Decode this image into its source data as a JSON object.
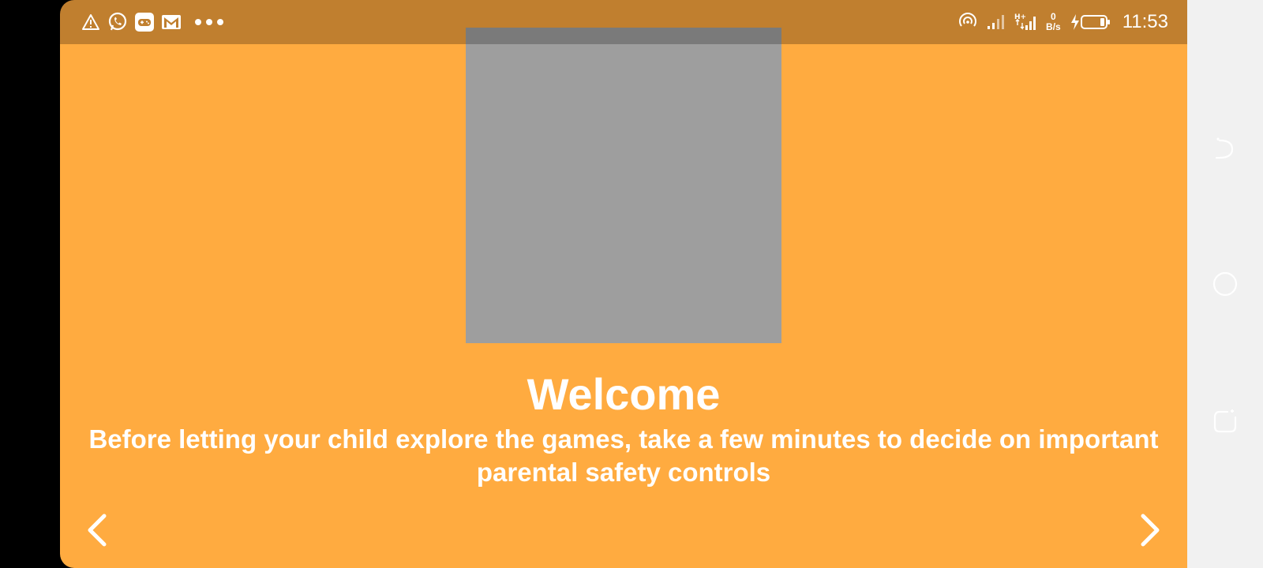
{
  "status_bar": {
    "left_icons": [
      "warning-icon",
      "whatsapp-icon",
      "game-controller-icon",
      "gmail-icon",
      "more-dots-icon"
    ],
    "net_speed_value": "0",
    "net_speed_unit": "B/s",
    "time": "11:53",
    "color": "#C07F2F"
  },
  "main": {
    "background_color": "#FFAB40",
    "image_placeholder_color": "#9E9E9E",
    "title": "Welcome",
    "subtitle": "Before letting your child explore the games, take a few minutes to decide on important parental safety controls"
  },
  "navigation": {
    "prev_icon": "chevron-left-icon",
    "next_icon": "chevron-right-icon"
  },
  "system_nav": {
    "items": [
      "back-icon",
      "home-icon",
      "recents-icon"
    ],
    "background_color": "#F1F1F1"
  }
}
